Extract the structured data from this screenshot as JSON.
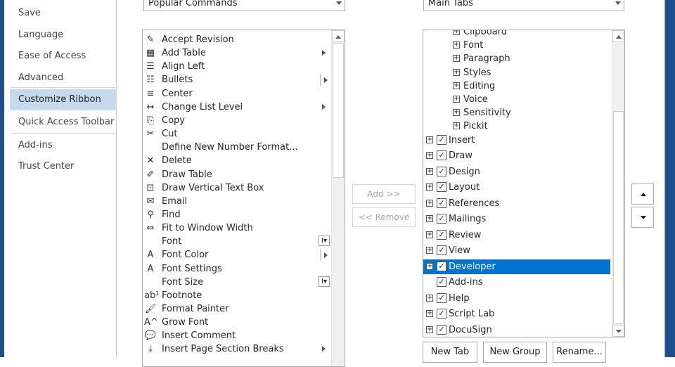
{
  "sidebar": {
    "items": [
      {
        "label": "Save"
      },
      {
        "label": "Language"
      },
      {
        "label": "Ease of Access"
      },
      {
        "label": "Advanced"
      },
      {
        "label": "Customize Ribbon",
        "active": true
      },
      {
        "label": "Quick Access Toolbar"
      },
      {
        "label": "Add-ins"
      },
      {
        "label": "Trust Center"
      }
    ]
  },
  "commands_dropdown": {
    "value": "Popular Commands"
  },
  "tabs_dropdown": {
    "value": "Main Tabs"
  },
  "commands": [
    {
      "label": "Accept Revision",
      "icon": "accept-revision-icon",
      "glyph": "✎"
    },
    {
      "label": "Add Table",
      "icon": "table-icon",
      "glyph": "▦",
      "submenu": "arrow"
    },
    {
      "label": "Align Left",
      "icon": "align-left-icon",
      "glyph": "☰"
    },
    {
      "label": "Bullets",
      "icon": "bullets-icon",
      "glyph": "☷",
      "submenu": "split"
    },
    {
      "label": "Center",
      "icon": "center-icon",
      "glyph": "≡"
    },
    {
      "label": "Change List Level",
      "icon": "list-level-icon",
      "glyph": "↔",
      "submenu": "arrow"
    },
    {
      "label": "Copy",
      "icon": "copy-icon",
      "glyph": "⎘"
    },
    {
      "label": "Cut",
      "icon": "scissors-icon",
      "glyph": "✂"
    },
    {
      "label": "Define New Number Format...",
      "icon": "",
      "glyph": ""
    },
    {
      "label": "Delete",
      "icon": "delete-comment-icon",
      "glyph": "✕"
    },
    {
      "label": "Draw Table",
      "icon": "draw-table-icon",
      "glyph": "✐"
    },
    {
      "label": "Draw Vertical Text Box",
      "icon": "text-box-icon",
      "glyph": "⊡"
    },
    {
      "label": "Email",
      "icon": "email-icon",
      "glyph": "✉"
    },
    {
      "label": "Find",
      "icon": "find-icon",
      "glyph": "⚲"
    },
    {
      "label": "Fit to Window Width",
      "icon": "fit-width-icon",
      "glyph": "⇔"
    },
    {
      "label": "Font",
      "icon": "",
      "glyph": "",
      "control": "I▾"
    },
    {
      "label": "Font Color",
      "icon": "font-color-icon",
      "glyph": "A",
      "submenu": "split"
    },
    {
      "label": "Font Settings",
      "icon": "font-settings-icon",
      "glyph": "A"
    },
    {
      "label": "Font Size",
      "icon": "",
      "glyph": "",
      "control": "I▾"
    },
    {
      "label": "Footnote",
      "icon": "footnote-icon",
      "glyph": "ab¹"
    },
    {
      "label": "Format Painter",
      "icon": "format-painter-icon",
      "glyph": "🖌"
    },
    {
      "label": "Grow Font",
      "icon": "grow-font-icon",
      "glyph": "A^"
    },
    {
      "label": "Insert Comment",
      "icon": "insert-comment-icon",
      "glyph": "💬"
    },
    {
      "label": "Insert Page  Section Breaks",
      "icon": "page-break-icon",
      "glyph": "⤓",
      "submenu": "arrow"
    }
  ],
  "tree": [
    {
      "label": "Clipboard",
      "level": 2,
      "expander": "+"
    },
    {
      "label": "Font",
      "level": 2,
      "expander": "+"
    },
    {
      "label": "Paragraph",
      "level": 2,
      "expander": "+"
    },
    {
      "label": "Styles",
      "level": 2,
      "expander": "+"
    },
    {
      "label": "Editing",
      "level": 2,
      "expander": "+"
    },
    {
      "label": "Voice",
      "level": 2,
      "expander": "+"
    },
    {
      "label": "Sensitivity",
      "level": 2,
      "expander": "+"
    },
    {
      "label": "Pickit",
      "level": 2,
      "expander": "+"
    },
    {
      "label": "Insert",
      "level": 1,
      "expander": "+",
      "checked": true
    },
    {
      "label": "Draw",
      "level": 1,
      "expander": "+",
      "checked": true
    },
    {
      "label": "Design",
      "level": 1,
      "expander": "+",
      "checked": true
    },
    {
      "label": "Layout",
      "level": 1,
      "expander": "+",
      "checked": true
    },
    {
      "label": "References",
      "level": 1,
      "expander": "+",
      "checked": true
    },
    {
      "label": "Mailings",
      "level": 1,
      "expander": "+",
      "checked": true
    },
    {
      "label": "Review",
      "level": 1,
      "expander": "+",
      "checked": true
    },
    {
      "label": "View",
      "level": 1,
      "expander": "+",
      "checked": true
    },
    {
      "label": "Developer",
      "level": 1,
      "expander": "+",
      "checked": true,
      "selected": true
    },
    {
      "label": "Add-ins",
      "level": 1,
      "expander": "",
      "checked": true
    },
    {
      "label": "Help",
      "level": 1,
      "expander": "+",
      "checked": true
    },
    {
      "label": "Script Lab",
      "level": 1,
      "expander": "+",
      "checked": true
    },
    {
      "label": "DocuSign",
      "level": 1,
      "expander": "+",
      "checked": true
    }
  ],
  "buttons": {
    "add": "Add >>",
    "remove": "<< Remove",
    "new_tab": "New Tab",
    "new_group": "New Group",
    "rename": "Rename..."
  },
  "glyphs": {
    "check": "✓",
    "expander": "+"
  }
}
